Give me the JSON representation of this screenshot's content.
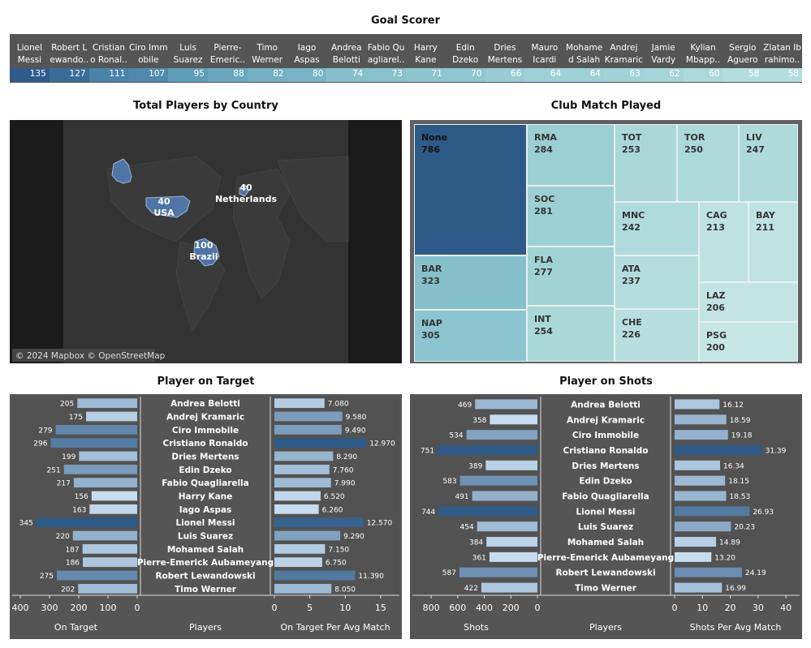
{
  "colors": {
    "dark": "#2e5a88",
    "light": "#d6ede8",
    "panel": "#555555",
    "bar_light": "#c6dcef"
  },
  "goal_scorer": {
    "title": "Goal Scorer",
    "players": [
      {
        "name": "Lionel Messi",
        "label": "Lionel\nMessi",
        "value": 135,
        "color": "#2f5b8b"
      },
      {
        "name": "Robert Lewandowski",
        "label": "Robert L\newando..",
        "value": 127,
        "color": "#3a6c97"
      },
      {
        "name": "Cristiano Ronaldo",
        "label": "Cristian\no Ronal..",
        "value": 111,
        "color": "#4a82a8"
      },
      {
        "name": "Ciro Immobile",
        "label": "Ciro Imm\nobile",
        "value": 107,
        "color": "#5189ad"
      },
      {
        "name": "Luis Suarez",
        "label": "Luis\nSuarez",
        "value": 95,
        "color": "#5f9db9"
      },
      {
        "name": "Pierre-Emerick",
        "label": "Pierre-\nEmeric..",
        "value": 88,
        "color": "#6aa7be"
      },
      {
        "name": "Timo Werner",
        "label": "Timo\nWerner",
        "value": 82,
        "color": "#75b1c3"
      },
      {
        "name": "Iago Aspas",
        "label": "Iago\nAspas",
        "value": 80,
        "color": "#78b4c5"
      },
      {
        "name": "Andrea Belotti",
        "label": "Andrea\nBelotti",
        "value": 74,
        "color": "#86bfcb"
      },
      {
        "name": "Fabio Quagliarella",
        "label": "Fabio Qu\nagliarel..",
        "value": 73,
        "color": "#88c1cc"
      },
      {
        "name": "Harry Kane",
        "label": "Harry\nKane",
        "value": 71,
        "color": "#8dc4ce"
      },
      {
        "name": "Edin Dzeko",
        "label": "Edin\nDzeko",
        "value": 70,
        "color": "#8fc6cf"
      },
      {
        "name": "Dries Mertens",
        "label": "Dries\nMertens",
        "value": 66,
        "color": "#99cdd3"
      },
      {
        "name": "Mauro Icardi",
        "label": "Mauro\nIcardi",
        "value": 64,
        "color": "#9ed1d5"
      },
      {
        "name": "Mohamed Salah",
        "label": "Mohame\nd Salah",
        "value": 64,
        "color": "#9ed1d5"
      },
      {
        "name": "Andrej Kramaric",
        "label": "Andrej\nKramaric",
        "value": 63,
        "color": "#a1d3d6"
      },
      {
        "name": "Jamie Vardy",
        "label": "Jamie\nVardy",
        "value": 62,
        "color": "#a5d5d8"
      },
      {
        "name": "Kylian Mbappe",
        "label": "Kylian\nMbapp..",
        "value": 60,
        "color": "#acd9db"
      },
      {
        "name": "Sergio Aguero",
        "label": "Sergio\nAguero",
        "value": 58,
        "color": "#b4dde0"
      },
      {
        "name": "Zlatan Ibrahimovic",
        "label": "Zlatan Ib\nrahimo..",
        "value": 58,
        "color": "#b4dde0"
      }
    ]
  },
  "map": {
    "title": "Total Players by Country",
    "attribution": "© 2024 Mapbox © OpenStreetMap",
    "countries": [
      {
        "name": "USA",
        "value": "40"
      },
      {
        "name": "Netherlands",
        "value": "40"
      },
      {
        "name": "Brazil",
        "value": "100"
      }
    ]
  },
  "treemap": {
    "title": "Club Match Played",
    "items": [
      {
        "club": "None",
        "value": "786",
        "color": "#2e5a88"
      },
      {
        "club": "BAR",
        "value": "323",
        "color": "#86c1cb"
      },
      {
        "club": "NAP",
        "value": "305",
        "color": "#8cc5cf"
      },
      {
        "club": "RMA",
        "value": "284",
        "color": "#9bcfd3"
      },
      {
        "club": "SOC",
        "value": "281",
        "color": "#9dd0d4"
      },
      {
        "club": "FLA",
        "value": "277",
        "color": "#a0d2d5"
      },
      {
        "club": "INT",
        "value": "254",
        "color": "#aad8d9"
      },
      {
        "club": "TOT",
        "value": "253",
        "color": "#aad8d9"
      },
      {
        "club": "TOR",
        "value": "250",
        "color": "#acd9da"
      },
      {
        "club": "LIV",
        "value": "247",
        "color": "#aedadb"
      },
      {
        "club": "MNC",
        "value": "242",
        "color": "#b0dbdc"
      },
      {
        "club": "ATA",
        "value": "237",
        "color": "#b3dcdd"
      },
      {
        "club": "CHE",
        "value": "226",
        "color": "#b8dfdf"
      },
      {
        "club": "CAG",
        "value": "213",
        "color": "#bfe2e1"
      },
      {
        "club": "BAY",
        "value": "211",
        "color": "#c0e3e2"
      },
      {
        "club": "LAZ",
        "value": "206",
        "color": "#c3e4e3"
      },
      {
        "club": "PSG",
        "value": "200",
        "color": "#c6e6e4"
      }
    ]
  },
  "chart_data": [
    {
      "type": "bar",
      "title": "Goal Scorer",
      "categories": [
        "Lionel Messi",
        "Robert Lewandowski",
        "Cristiano Ronaldo",
        "Ciro Immobile",
        "Luis Suarez",
        "Pierre-Emerick",
        "Timo Werner",
        "Iago Aspas",
        "Andrea Belotti",
        "Fabio Quagliarella",
        "Harry Kane",
        "Edin Dzeko",
        "Dries Mertens",
        "Mauro Icardi",
        "Mohamed Salah",
        "Andrej Kramaric",
        "Jamie Vardy",
        "Kylian Mbappe",
        "Sergio Aguero",
        "Zlatan Ibrahimovic"
      ],
      "values": [
        135,
        127,
        111,
        107,
        95,
        88,
        82,
        80,
        74,
        73,
        71,
        70,
        66,
        64,
        64,
        63,
        62,
        60,
        58,
        58
      ]
    },
    {
      "type": "bar",
      "title": "Player on Target",
      "categories": [
        "Andrea Belotti",
        "Andrej Kramaric",
        "Ciro Immobile",
        "Cristiano Ronaldo",
        "Dries Mertens",
        "Edin Dzeko",
        "Fabio Quagliarella",
        "Harry Kane",
        "Iago Aspas",
        "Lionel Messi",
        "Luis Suarez",
        "Mohamed Salah",
        "Pierre-Emerick Aubameyang",
        "Robert Lewandowski",
        "Timo Werner"
      ],
      "center_label": "Players",
      "left": {
        "xlabel": "On Target",
        "ticks": [
          "400",
          "300",
          "200",
          "100",
          "0"
        ],
        "xlim": [
          0,
          400
        ],
        "values": [
          205,
          175,
          279,
          296,
          199,
          251,
          217,
          156,
          163,
          345,
          220,
          187,
          186,
          275,
          202
        ],
        "labels": [
          "205",
          "175",
          "279",
          "296",
          "199",
          "251",
          "217",
          "156",
          "163",
          "345",
          "220",
          "187",
          "186",
          "275",
          "202"
        ]
      },
      "right": {
        "xlabel": "On Target Per Avg Match",
        "ticks": [
          "0",
          "5",
          "10",
          "15"
        ],
        "xlim": [
          0,
          16.5
        ],
        "values": [
          7.08,
          9.58,
          9.49,
          12.97,
          8.29,
          7.76,
          7.99,
          6.52,
          6.26,
          12.57,
          9.29,
          7.15,
          6.75,
          11.39,
          8.05
        ],
        "labels": [
          "7.080",
          "9.580",
          "9.490",
          "12.970",
          "8.290",
          "7.760",
          "7.990",
          "6.520",
          "6.260",
          "12.570",
          "9.290",
          "7.150",
          "6.750",
          "11.390",
          "8.050"
        ]
      }
    },
    {
      "type": "bar",
      "title": "Player on Shots",
      "categories": [
        "Andrea Belotti",
        "Andrej Kramaric",
        "Ciro Immobile",
        "Cristiano Ronaldo",
        "Dries Mertens",
        "Edin Dzeko",
        "Fabio Quagliarella",
        "Lionel Messi",
        "Luis Suarez",
        "Mohamed Salah",
        "Pierre-Emerick Aubameyang",
        "Robert Lewandowski",
        "Timo Werner"
      ],
      "center_label": "Players",
      "left": {
        "xlabel": "Shots",
        "ticks": [
          "800",
          "600",
          "400",
          "200",
          "0"
        ],
        "xlim": [
          0,
          880
        ],
        "values": [
          469,
          358,
          534,
          751,
          389,
          583,
          491,
          744,
          454,
          384,
          361,
          587,
          422
        ],
        "labels": [
          "469",
          "358",
          "534",
          "751",
          "389",
          "583",
          "491",
          "744",
          "454",
          "384",
          "361",
          "587",
          "422"
        ]
      },
      "right": {
        "xlabel": "Shots Per Avg Match",
        "ticks": [
          "0",
          "10",
          "20",
          "30",
          "40"
        ],
        "xlim": [
          0,
          42
        ],
        "values": [
          16.12,
          18.59,
          19.18,
          31.39,
          16.34,
          18.15,
          18.53,
          26.93,
          20.23,
          14.89,
          13.2,
          24.19,
          16.99
        ],
        "labels": [
          "16.12",
          "18.59",
          "19.18",
          "31.39",
          "16.34",
          "18.15",
          "18.53",
          "26.93",
          "20.23",
          "14.89",
          "13.20",
          "24.19",
          "16.99"
        ]
      }
    }
  ]
}
